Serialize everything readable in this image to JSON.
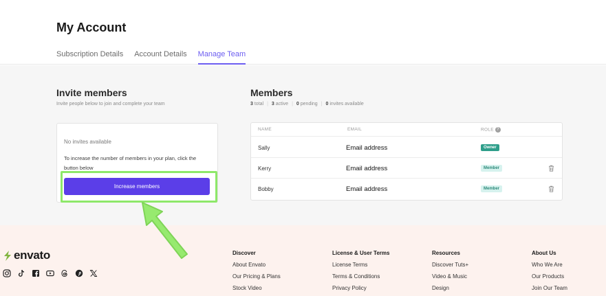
{
  "header": {
    "title": "My Account",
    "tabs": [
      {
        "label": "Subscription Details",
        "active": false
      },
      {
        "label": "Account Details",
        "active": false
      },
      {
        "label": "Manage Team",
        "active": true
      }
    ]
  },
  "invite": {
    "title": "Invite members",
    "subtitle": "Invite people below to join and complete your team",
    "no_invites": "No invites available",
    "description": "To increase the number of members in your plan, click the button below",
    "button_label": "Increase members"
  },
  "members": {
    "title": "Members",
    "stats": {
      "total": "3",
      "total_label": "total",
      "active": "3",
      "active_label": "active",
      "pending": "0",
      "pending_label": "pending",
      "invites": "0",
      "invites_label": "invites available"
    },
    "columns": {
      "name": "NAME",
      "email": "EMAIL",
      "role": "ROLE"
    },
    "rows": [
      {
        "name": "Sally",
        "email": "Email address",
        "role": "Owner"
      },
      {
        "name": "Kerry",
        "email": "Email address",
        "role": "Member"
      },
      {
        "name": "Bobby",
        "email": "Email address",
        "role": "Member"
      }
    ]
  },
  "footer": {
    "logo": "envato",
    "columns": [
      {
        "heading": "Discover",
        "links": [
          "About Envato",
          "Our Pricing & Plans",
          "Stock Video"
        ]
      },
      {
        "heading": "License & User Terms",
        "links": [
          "License Terms",
          "Terms & Conditions",
          "Privacy Policy"
        ]
      },
      {
        "heading": "Resources",
        "links": [
          "Discover Tuts+",
          "Video & Music",
          "Design"
        ]
      },
      {
        "heading": "About Us",
        "links": [
          "Who We Are",
          "Our Products",
          "Join Our Team"
        ]
      }
    ],
    "socials": [
      "instagram-icon",
      "tiktok-icon",
      "facebook-icon",
      "youtube-icon",
      "threads-icon",
      "pinterest-icon",
      "x-icon"
    ]
  },
  "colors": {
    "accent": "#6b5cf0",
    "button": "#5b3ee8",
    "highlight": "#8ee86a",
    "owner_badge": "#2e9e8a",
    "member_badge": "#d6f2ee",
    "footer_bg": "#fdf2ee",
    "logo_green": "#82b541"
  }
}
